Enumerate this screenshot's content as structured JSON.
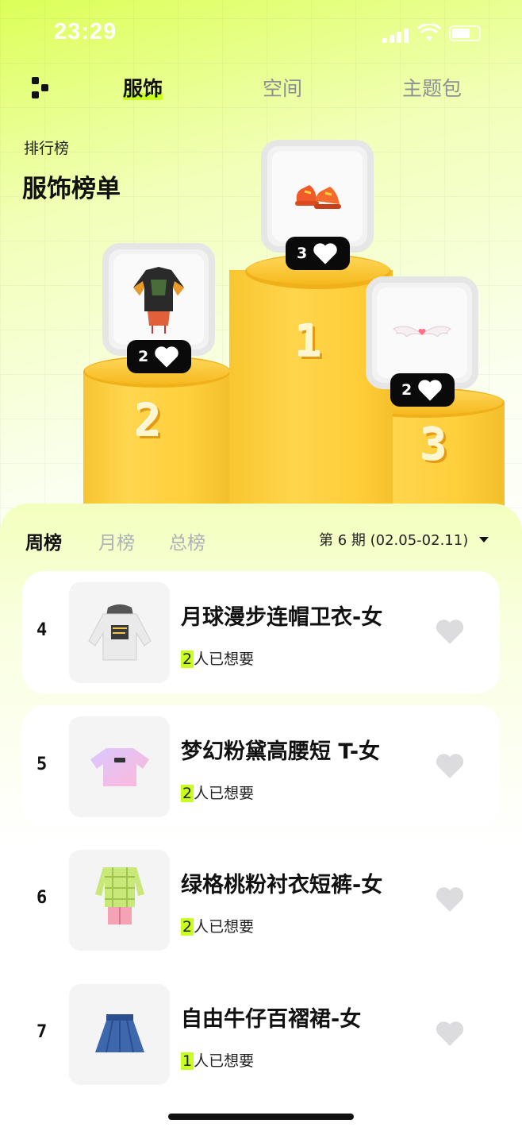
{
  "status_bar": {
    "time": "23:29"
  },
  "nav": {
    "tabs": [
      {
        "label": "服饰",
        "active": true
      },
      {
        "label": "空间",
        "active": false
      },
      {
        "label": "主题包",
        "active": false
      }
    ],
    "share_icon": "share-icon"
  },
  "header": {
    "small": "排行榜",
    "title": "服饰榜单"
  },
  "podium": {
    "first": {
      "rank": "1",
      "likes": "3",
      "item_icon": "sneakers-icon"
    },
    "second": {
      "rank": "2",
      "likes": "2",
      "item_icon": "jacket-icon"
    },
    "third": {
      "rank": "3",
      "likes": "2",
      "item_icon": "wings-icon"
    }
  },
  "period_tabs": [
    {
      "label": "周榜",
      "active": true
    },
    {
      "label": "月榜",
      "active": false
    },
    {
      "label": "总榜",
      "active": false
    }
  ],
  "issue": {
    "label": "第 6 期 (02.05-02.11)"
  },
  "list": [
    {
      "rank": "4",
      "title": "月球漫步连帽卫衣-女",
      "count": "2",
      "suffix": "人已想要",
      "item_icon": "hoodie-icon"
    },
    {
      "rank": "5",
      "title": "梦幻粉黛高腰短 T-女",
      "count": "2",
      "suffix": "人已想要",
      "item_icon": "crop-tshirt-icon"
    },
    {
      "rank": "6",
      "title": "绿格桃粉衬衣短裤-女",
      "count": "2",
      "suffix": "人已想要",
      "item_icon": "plaid-shirt-icon"
    },
    {
      "rank": "7",
      "title": "自由牛仔百褶裙-女",
      "count": "1",
      "suffix": "人已想要",
      "item_icon": "denim-skirt-icon"
    }
  ],
  "colors": {
    "accent": "#c8ff1f",
    "podium_gold": "#ffcf3c",
    "like_pill": "#0a0a0a"
  }
}
